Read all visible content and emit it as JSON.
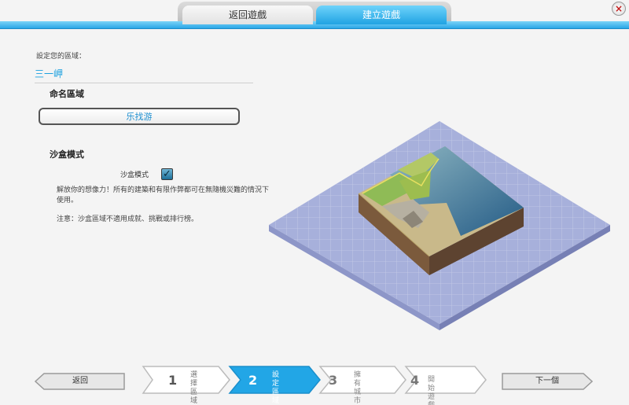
{
  "tabs": [
    {
      "label": "返回遊戲"
    },
    {
      "label": "建立遊戲"
    }
  ],
  "close_button": {
    "label": "×"
  },
  "setup": {
    "section_label": "設定您的區域：",
    "region_name": "三一岬",
    "name_heading": "命名區域",
    "name_value": "乐找游",
    "sandbox_heading": "沙盒模式",
    "sandbox_checkbox_label": "沙盒模式",
    "sandbox_checked": true,
    "description": "解放你的想像力！所有的建築和有限作弊都可在無隨機災難的情況下使用。",
    "note": "注意：沙盒區域不適用成就、挑戰或排行榜。"
  },
  "nav": {
    "back_label": "返回",
    "next_label": "下一個",
    "steps": [
      {
        "number": "1",
        "line1": "選擇",
        "line2": "區域",
        "active": false
      },
      {
        "number": "2",
        "line1": "設定",
        "line2": "區域",
        "active": true
      },
      {
        "number": "3",
        "line1": "擁有",
        "line2": "城市",
        "active": false
      },
      {
        "number": "4",
        "line1": "開始遊戲",
        "line2": "",
        "active": false
      }
    ]
  },
  "colors": {
    "accent": "#1aa0df",
    "active_step": "#22a6e6",
    "background": "#f4f4f4"
  }
}
